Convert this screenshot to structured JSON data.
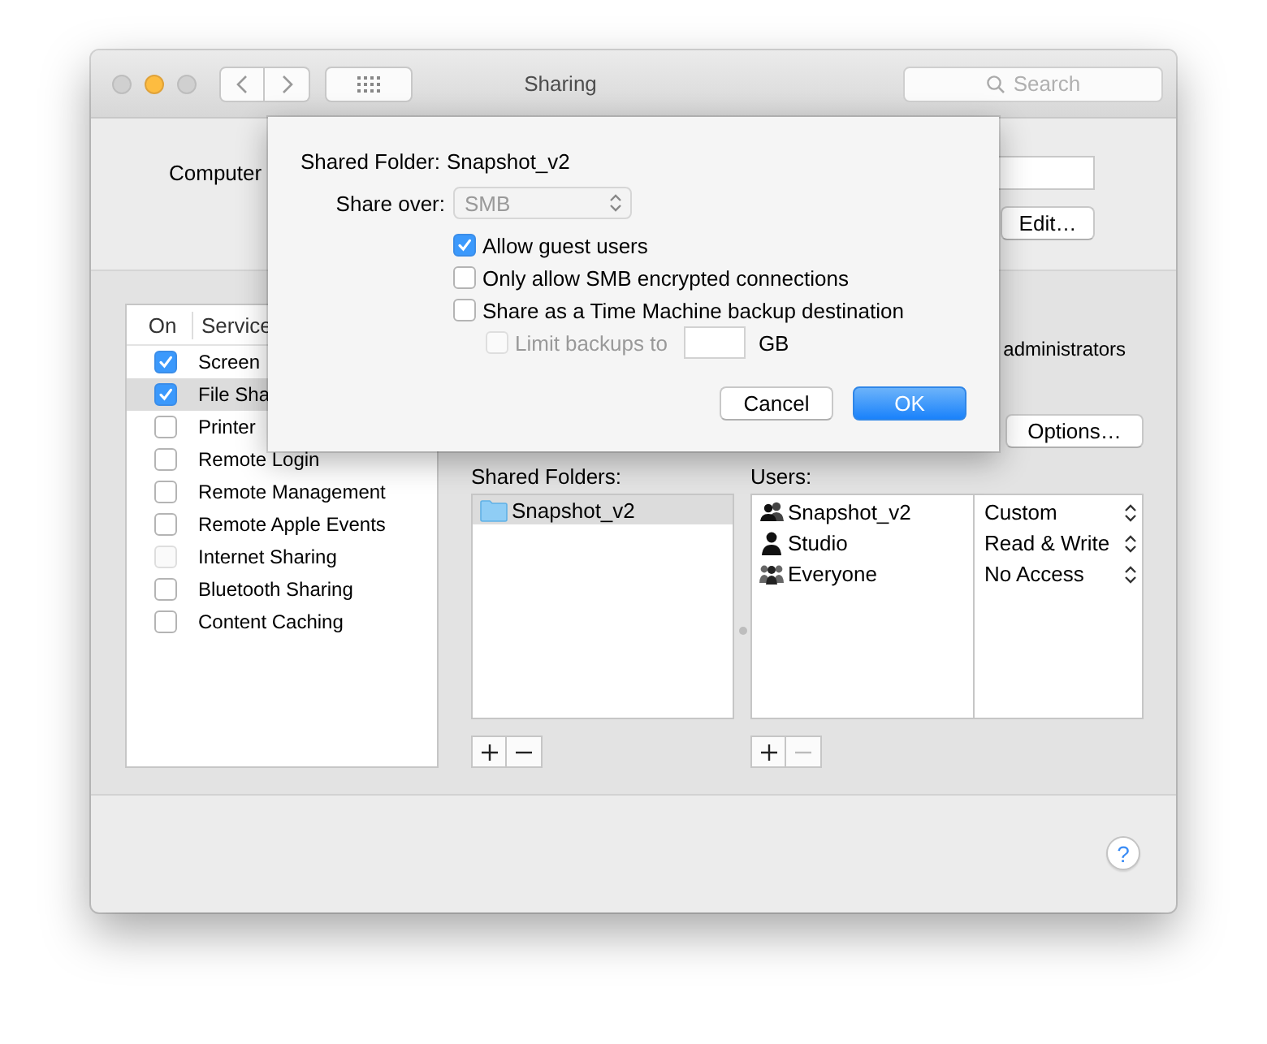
{
  "window": {
    "title": "Sharing",
    "search": {
      "placeholder": "Search"
    }
  },
  "computer_name": {
    "label": "Computer",
    "button": "Edit…"
  },
  "services": {
    "columns": [
      "On",
      "Service"
    ],
    "items": [
      {
        "name": "Screen",
        "on": true,
        "selected": false,
        "disabled": false
      },
      {
        "name": "File Sha",
        "on": true,
        "selected": true,
        "disabled": false
      },
      {
        "name": "Printer",
        "on": false,
        "selected": false,
        "disabled": false
      },
      {
        "name": "Remote Login",
        "on": false,
        "selected": false,
        "disabled": false
      },
      {
        "name": "Remote Management",
        "on": false,
        "selected": false,
        "disabled": false
      },
      {
        "name": "Remote Apple Events",
        "on": false,
        "selected": false,
        "disabled": false
      },
      {
        "name": "Internet Sharing",
        "on": false,
        "selected": false,
        "disabled": true
      },
      {
        "name": "Bluetooth Sharing",
        "on": false,
        "selected": false,
        "disabled": false
      },
      {
        "name": "Content Caching",
        "on": false,
        "selected": false,
        "disabled": false
      }
    ]
  },
  "access_note": "administrators",
  "options_button": "Options…",
  "shared_folders": {
    "label": "Shared Folders:",
    "items": [
      {
        "name": "Snapshot_v2",
        "selected": true
      }
    ]
  },
  "users": {
    "label": "Users:",
    "items": [
      {
        "name": "Snapshot_v2",
        "kind": "group",
        "permission": "Custom"
      },
      {
        "name": "Studio",
        "kind": "user",
        "permission": "Read & Write"
      },
      {
        "name": "Everyone",
        "kind": "everyone",
        "permission": "No Access"
      }
    ]
  },
  "help": "?",
  "sheet": {
    "folder_label": "Shared Folder:",
    "folder": "Snapshot_v2",
    "share_over": {
      "label": "Share over:",
      "value": "SMB",
      "disabled": true
    },
    "options": [
      {
        "label": "Allow guest users",
        "checked": true,
        "disabled": false
      },
      {
        "label": "Only allow SMB encrypted connections",
        "checked": false,
        "disabled": false
      },
      {
        "label": "Share as a Time Machine backup destination",
        "checked": false,
        "disabled": false
      }
    ],
    "limit": {
      "label": "Limit backups to",
      "checked": false,
      "disabled": true,
      "unit": "GB"
    },
    "buttons": [
      {
        "label": "Cancel",
        "default": false
      },
      {
        "label": "OK",
        "default": true
      }
    ]
  }
}
